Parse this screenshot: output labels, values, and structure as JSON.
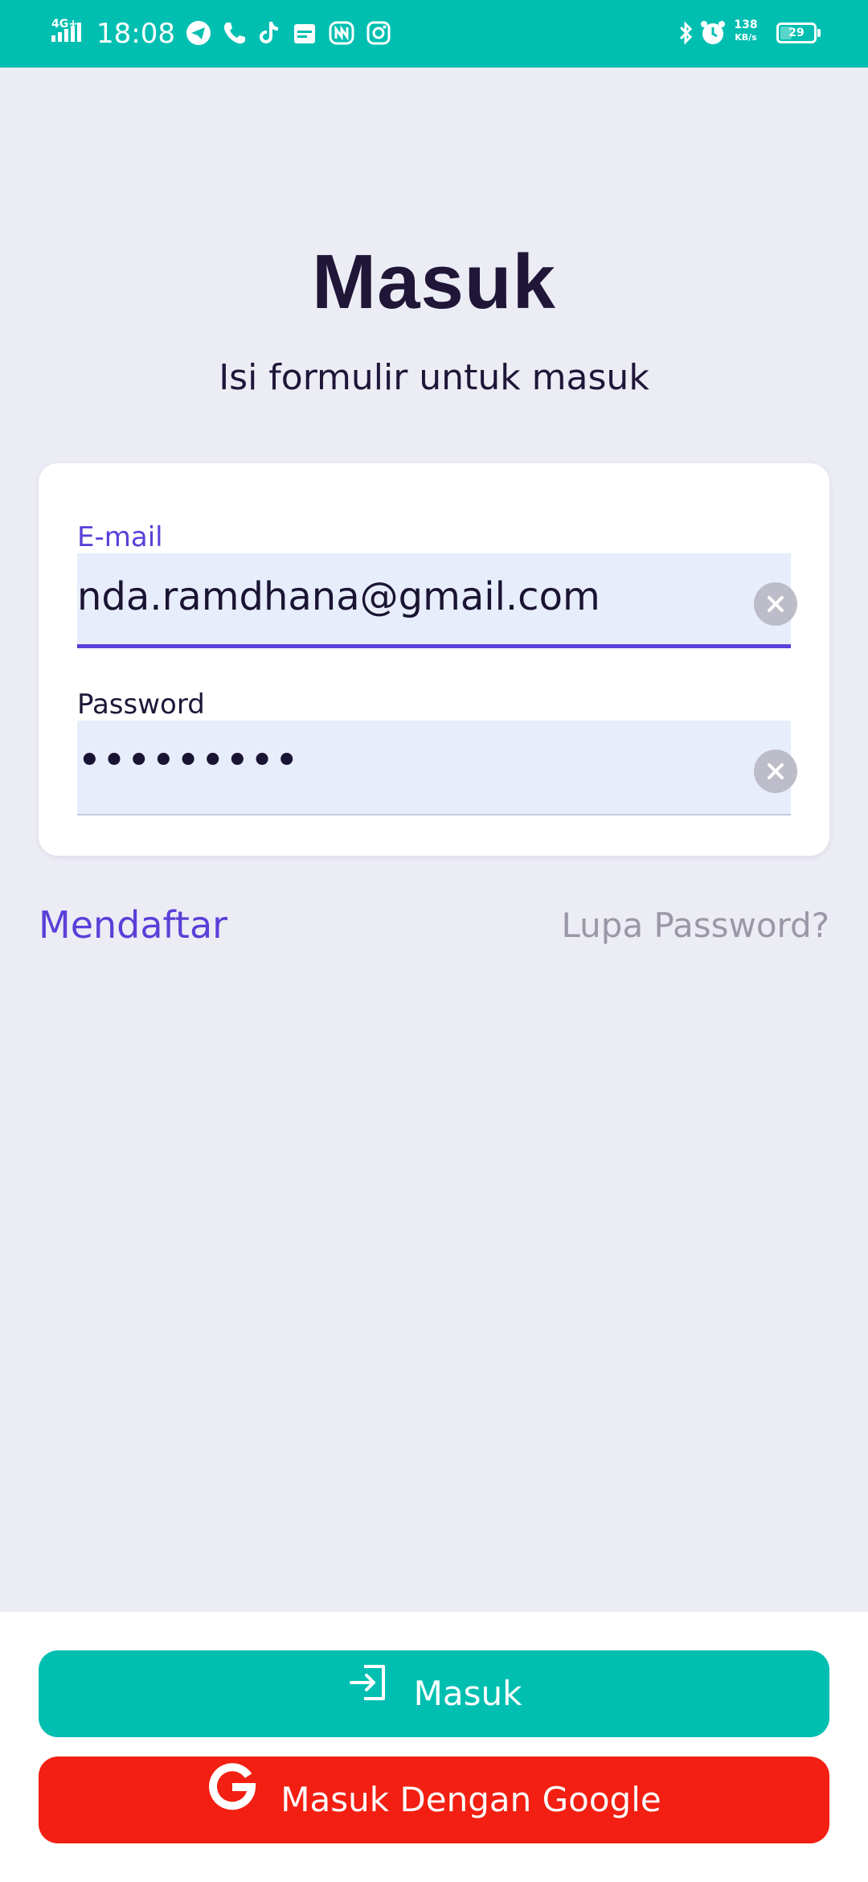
{
  "status_bar": {
    "network": "4G+",
    "time": "18:08",
    "net_speed_value": "138",
    "net_speed_unit": "KB/s",
    "battery_level": "29",
    "left_icons": [
      "telegram-icon",
      "phone-call-icon",
      "tiktok-icon",
      "calendar-icon",
      "app-logo-icon",
      "instagram-icon"
    ],
    "right_icons": [
      "bluetooth-icon",
      "alarm-icon"
    ]
  },
  "header": {
    "title": "Masuk",
    "subtitle": "Isi formulir untuk masuk"
  },
  "form": {
    "email": {
      "label": "E-mail",
      "value": "nda.ramdhana@gmail.com"
    },
    "password": {
      "label": "Password",
      "value": "•••••••••"
    }
  },
  "links": {
    "register": "Mendaftar",
    "forgot_password": "Lupa Password?"
  },
  "actions": {
    "login_label": "Masuk",
    "google_label": "Masuk Dengan Google"
  },
  "colors": {
    "primary_teal": "#00bfb1",
    "accent_purple": "#5b3fd8",
    "google_red": "#f21f12",
    "background": "#ececf5",
    "title_text": "#1f1638"
  }
}
